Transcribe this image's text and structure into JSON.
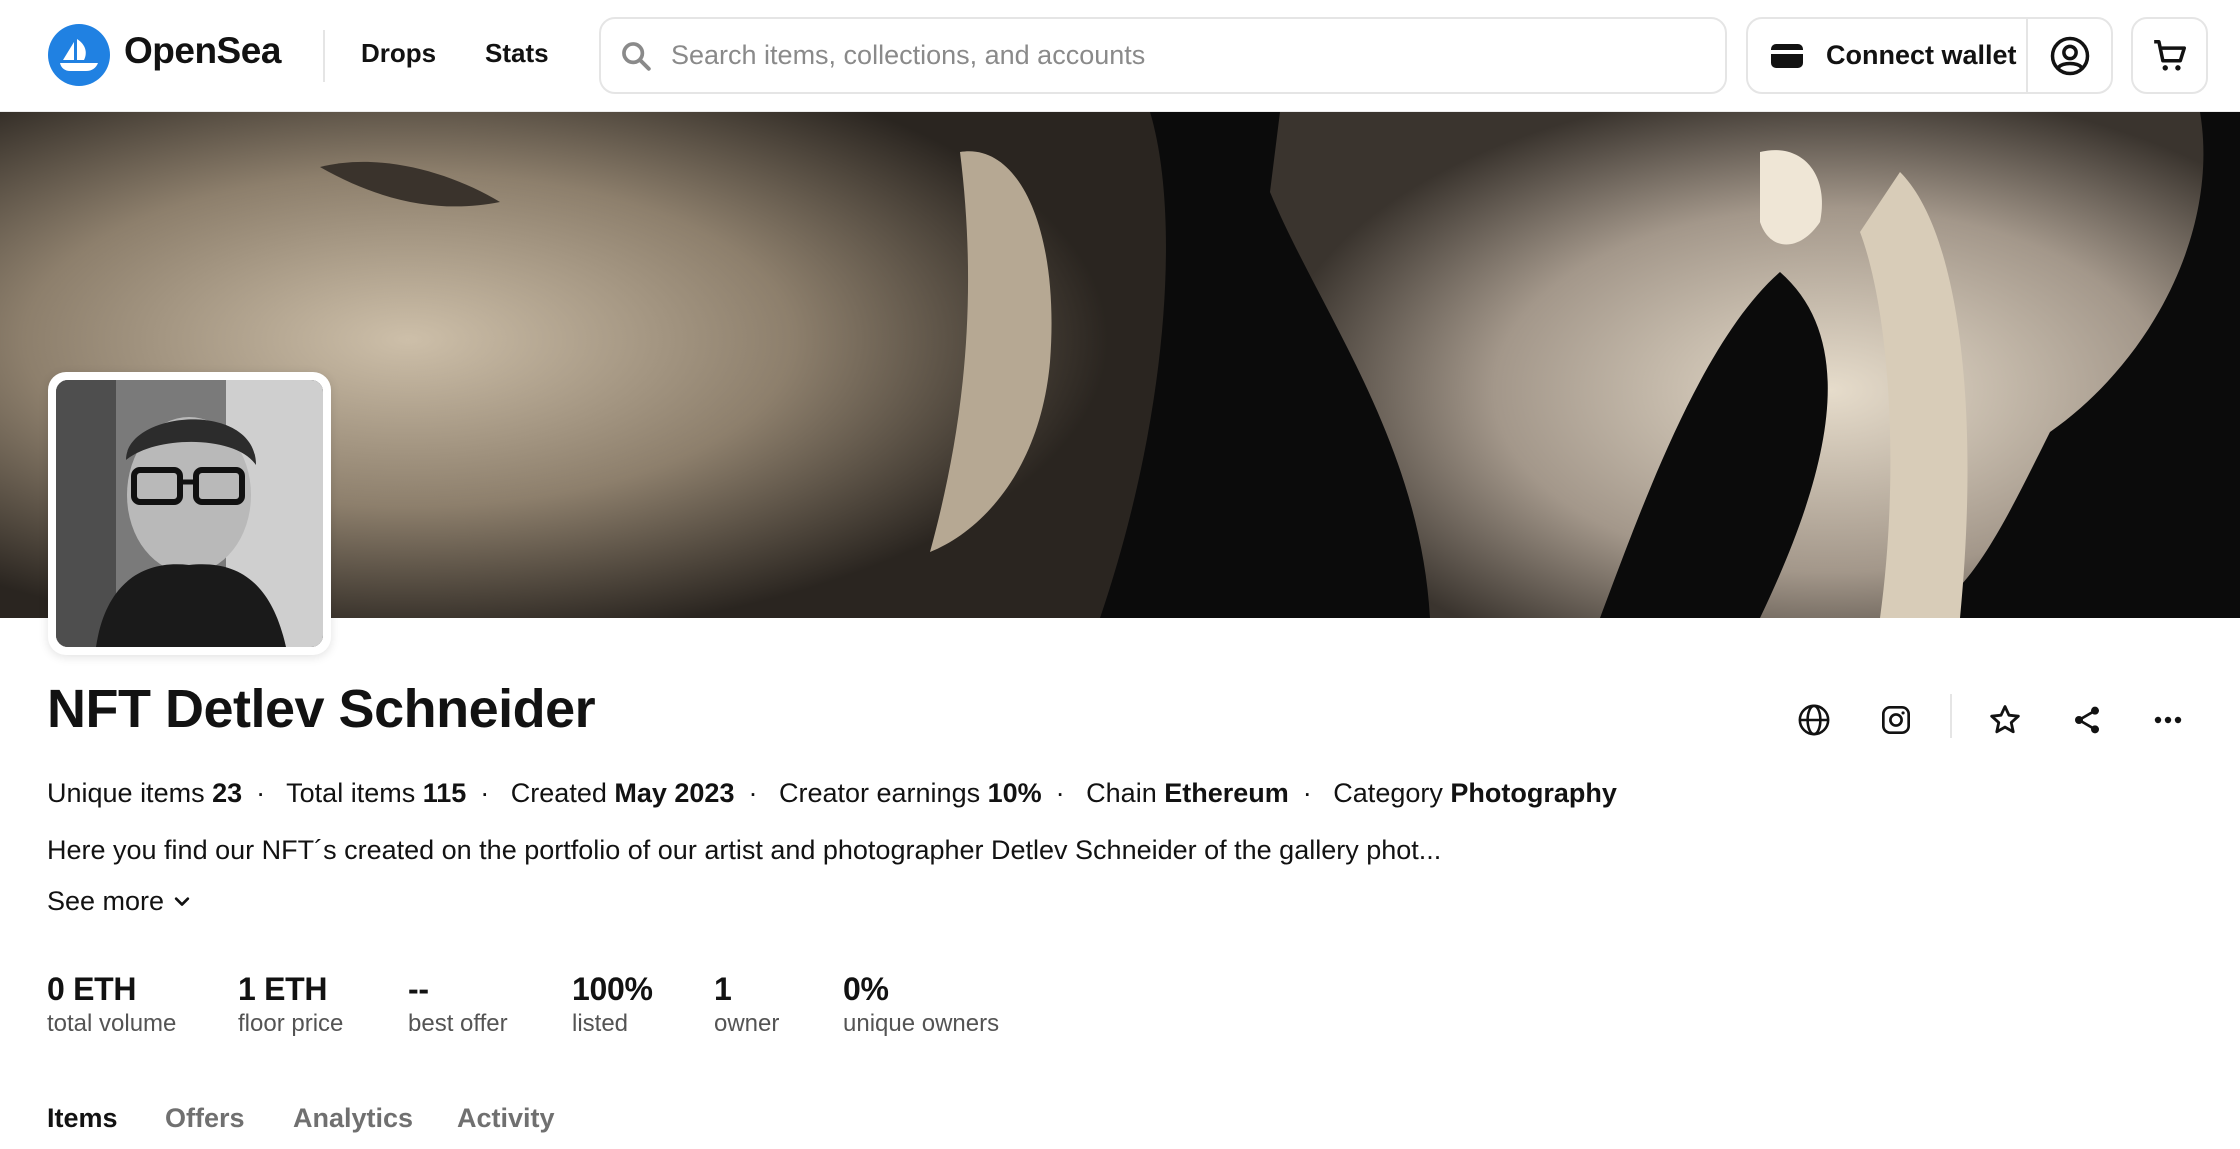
{
  "header": {
    "brand": "OpenSea",
    "nav": [
      "Drops",
      "Stats"
    ],
    "search_placeholder": "Search items, collections, and accounts",
    "connect_wallet": "Connect wallet",
    "icons": [
      "opensea-logo-icon",
      "search-icon",
      "wallet-icon",
      "account-icon",
      "cart-icon"
    ]
  },
  "collection": {
    "name": "NFT Detlev Schneider",
    "meta": [
      {
        "label": "Unique items",
        "value": "23"
      },
      {
        "label": "Total items",
        "value": "115"
      },
      {
        "label": "Created",
        "value": "May 2023"
      },
      {
        "label": "Creator earnings",
        "value": "10%"
      },
      {
        "label": "Chain",
        "value": "Ethereum"
      },
      {
        "label": "Category",
        "value": "Photography"
      }
    ],
    "description": "Here you find our NFT´s created on the portfolio of our artist and photographer Detlev Schneider of the gallery phot...",
    "see_more": "See more",
    "action_icons": [
      "globe-icon",
      "instagram-icon",
      "star-icon",
      "share-icon",
      "more-icon"
    ]
  },
  "stats": [
    {
      "value": "0 ETH",
      "label": "total volume"
    },
    {
      "value": "1 ETH",
      "label": "floor price"
    },
    {
      "value": "--",
      "label": "best offer"
    },
    {
      "value": "100%",
      "label": "listed"
    },
    {
      "value": "1",
      "label": "owner"
    },
    {
      "value": "0%",
      "label": "unique owners"
    }
  ],
  "tabs": [
    {
      "label": "Items",
      "active": true
    },
    {
      "label": "Offers",
      "active": false
    },
    {
      "label": "Analytics",
      "active": false
    },
    {
      "label": "Activity",
      "active": false
    }
  ],
  "colors": {
    "brand_blue": "#2081e2",
    "text": "#121212",
    "muted": "#545454"
  }
}
